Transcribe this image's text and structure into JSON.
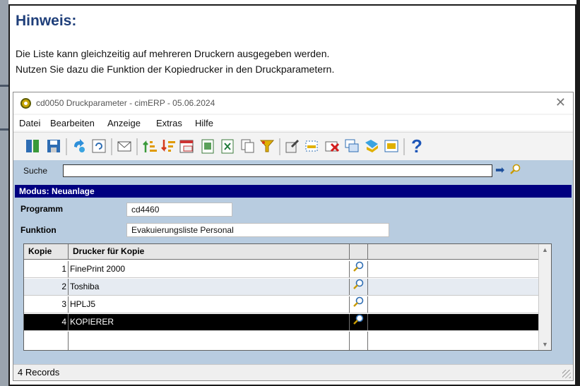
{
  "hint": {
    "title": "Hinweis:",
    "line1": "Die Liste kann gleichzeitig auf mehreren Druckern ausgegeben werden.",
    "line2": "Nutzen Sie dazu die Funktion der Kopiedrucker in den Druckparametern."
  },
  "window": {
    "title": "cd0050 Druckparameter - cimERP - 05.06.2024",
    "close": "✕"
  },
  "menu": [
    "Datei",
    "Bearbeiten",
    "Anzeige",
    "Extras",
    "Hilfe"
  ],
  "toolbar_icons": [
    "exit-icon",
    "save-icon",
    "undo-icon",
    "refresh-icon",
    "mail-icon",
    "sort-asc-icon",
    "sort-desc-icon",
    "calendar-icon",
    "export-icon",
    "excel-icon",
    "copy-icon",
    "filter-icon",
    "edit-icon",
    "add-row-icon",
    "delete-row-icon",
    "windows-icon",
    "tag-icon",
    "calculator-icon",
    "help-icon"
  ],
  "search": {
    "label": "Suche",
    "value": ""
  },
  "mode": "Modus: Neuanlage",
  "form": {
    "programm_label": "Programm",
    "programm_value": "cd4460",
    "funktion_label": "Funktion",
    "funktion_value": "Evakuierungsliste Personal"
  },
  "table": {
    "columns": [
      "Kopie",
      "Drucker für Kopie",
      "",
      ""
    ],
    "rows": [
      {
        "kopie": "1",
        "drucker": "FinePrint 2000",
        "extra": ""
      },
      {
        "kopie": "2",
        "drucker": "Toshiba",
        "extra": ""
      },
      {
        "kopie": "3",
        "drucker": "HPLJ5",
        "extra": ""
      },
      {
        "kopie": "4",
        "drucker": "KOPIERER",
        "extra": ""
      }
    ],
    "selected_row": 3
  },
  "status": "4 Records",
  "colors": {
    "hint_title": "#1f3f7a",
    "mode_bar": "#000080",
    "panel_bg": "#b8cce0",
    "selected_row": "#000000",
    "alt_row": "#e6ebf2"
  }
}
